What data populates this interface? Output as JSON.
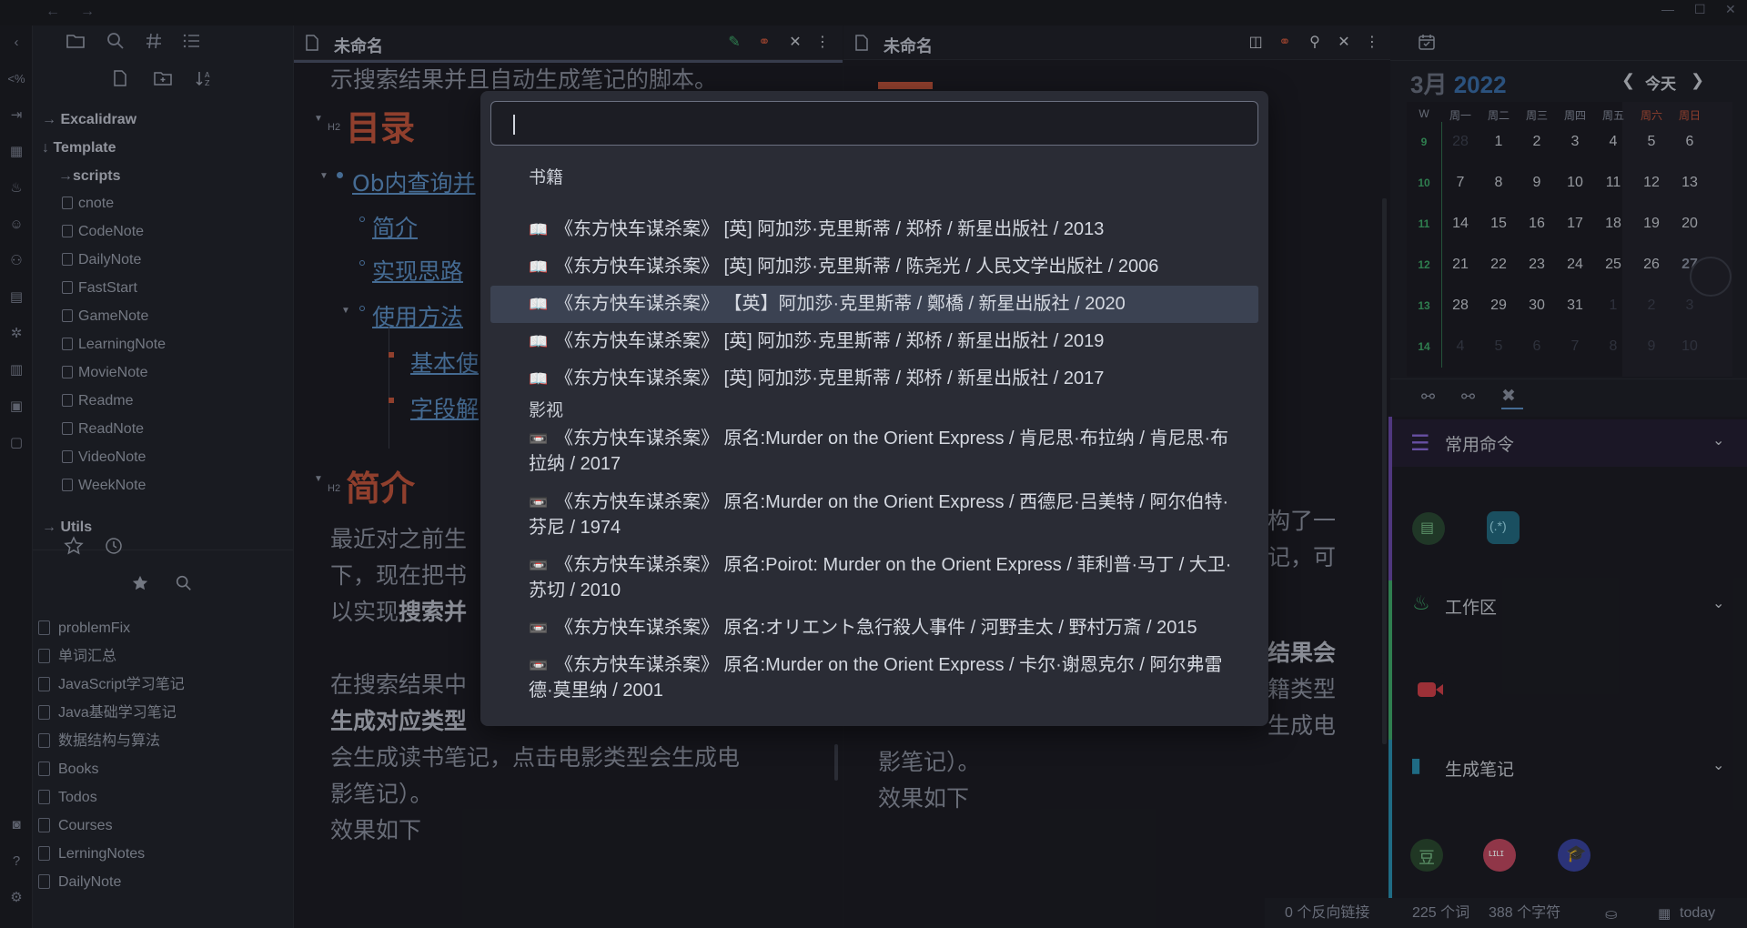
{
  "topbar": {
    "back": "←",
    "forward": "→"
  },
  "left_tabs": [
    "files-tab",
    "search-tab",
    "tags-tab",
    "outline-tab"
  ],
  "file_tree": {
    "folders_top": [
      "Excalidraw",
      "Template"
    ],
    "subfolder": "scripts",
    "files": [
      "cnote",
      "CodeNote",
      "DailyNote",
      "FastStart",
      "GameNote",
      "LearningNote",
      "MovieNote",
      "Readme",
      "ReadNote",
      "VideoNote",
      "WeekNote"
    ],
    "folder_bottom": "Utils"
  },
  "bookmarks": [
    "problemFix",
    "单词汇总",
    "JavaScript学习笔记",
    "Java基础学习笔记",
    "数据结构与算法",
    "Books",
    "Todos",
    "Courses",
    "LerningNotes",
    "DailyNote"
  ],
  "pane_left": {
    "title": "未命名",
    "top_text": "示搜索结果并且自动生成笔记的脚本。",
    "h2_label": "H2",
    "heading_toc": "目录",
    "toc": [
      "Ob内查询并",
      "简介",
      "实现思路",
      "使用方法",
      "基本使",
      "字段解"
    ],
    "heading_intro": "简介",
    "para1": "最近对之前生",
    "para2": "下，现在把书",
    "para3_prefix": "以实现",
    "para3_bold": "搜索并",
    "para4": "在搜索结果中",
    "para5_bold": "生成对应类型",
    "para6": "会生成读书笔记，点击电影类型会生成电",
    "para7": "影笔记）。",
    "para8": "效果如下"
  },
  "pane_right": {
    "title": "未命名",
    "frag1": "构了一",
    "frag2": "记，可",
    "frag3": "结果会",
    "frag4": "籍类型",
    "frag5": "生成电",
    "para7": "影笔记）。",
    "para8": "效果如下"
  },
  "calendar": {
    "month": "3月",
    "year": "2022",
    "today_btn": "今天",
    "week_label": "W",
    "dow": [
      "周一",
      "周二",
      "周三",
      "周四",
      "周五",
      "周六",
      "周日"
    ],
    "weeks": [
      {
        "wk": "9",
        "days": [
          "28",
          "1",
          "2",
          "3",
          "4",
          "5",
          "6"
        ]
      },
      {
        "wk": "10",
        "days": [
          "7",
          "8",
          "9",
          "10",
          "11",
          "12",
          "13"
        ]
      },
      {
        "wk": "11",
        "days": [
          "14",
          "15",
          "16",
          "17",
          "18",
          "19",
          "20"
        ]
      },
      {
        "wk": "12",
        "days": [
          "21",
          "22",
          "23",
          "24",
          "25",
          "26",
          "27"
        ]
      },
      {
        "wk": "13",
        "days": [
          "28",
          "29",
          "30",
          "31",
          "1",
          "2",
          "3"
        ]
      },
      {
        "wk": "14",
        "days": [
          "4",
          "5",
          "6",
          "7",
          "8",
          "9",
          "10"
        ]
      }
    ]
  },
  "commands": {
    "group1": "常用命令",
    "group2": "工作区",
    "group3": "生成笔记",
    "regex_btn": "(.*)",
    "douban_btn": "豆",
    "bili_btn": "ʟɪʟɪ"
  },
  "status": {
    "backlinks": "0 个反向链接",
    "words": "225 个词",
    "chars": "388 个字符",
    "today": "today"
  },
  "search_modal": {
    "query": "",
    "group_books": "书籍",
    "group_films": "影视",
    "books": [
      "《东方快车谋杀案》 [英] 阿加莎·克里斯蒂 / 郑桥 / 新星出版社 / 2013",
      "《东方快车谋杀案》 [英] 阿加莎·克里斯蒂 / 陈尧光 / 人民文学出版社 / 2006",
      "《东方快车谋杀案》 【英】阿加莎·克里斯蒂 / 鄭橋 / 新星出版社 / 2020",
      "《东方快车谋杀案》 [英] 阿加莎·克里斯蒂 / 郑桥 / 新星出版社 / 2019",
      "《东方快车谋杀案》 [英] 阿加莎·克里斯蒂 / 郑桥 / 新星出版社 / 2017"
    ],
    "films": [
      "《东方快车谋杀案》 原名:Murder on the Orient Express / 肯尼思·布拉纳 / 肯尼思·布拉纳 / 2017",
      "《东方快车谋杀案》 原名:Murder on the Orient Express / 西德尼·吕美特 / 阿尔伯特·芬尼 / 1974",
      "《东方快车谋杀案》 原名:Poirot: Murder on the Orient Express / 菲利普·马丁 / 大卫·苏切 / 2010",
      "《东方快车谋杀案》 原名:オリエント急行殺人事件 / 河野圭太 / 野村万斎 / 2015",
      "《东方快车谋杀案》 原名:Murder on the Orient Express / 卡尔·谢恩克尔 / 阿尔弗雷德·莫里纳 / 2001"
    ],
    "book_icon": "📖",
    "film_icon": "📼"
  },
  "colors": {
    "accent_heading": "#c0553c",
    "link": "#5d8fc4",
    "week_green": "#3fa86a",
    "selected": "#3b4252"
  }
}
